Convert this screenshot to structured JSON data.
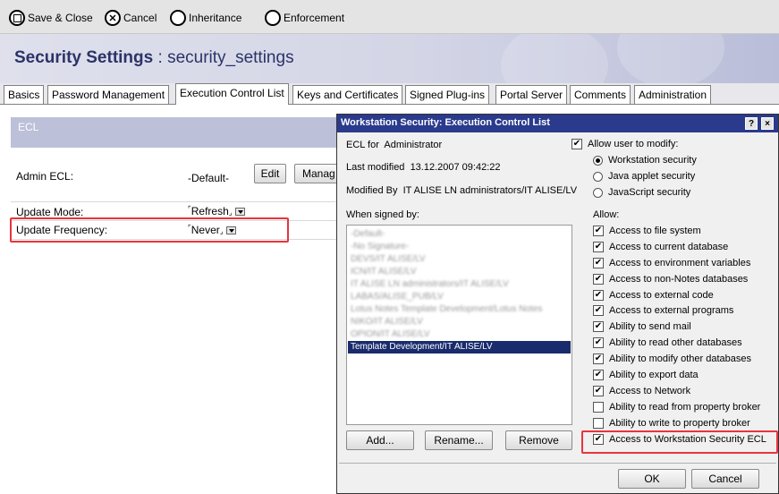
{
  "toolbar": {
    "save_close": "Save & Close",
    "cancel": "Cancel",
    "inheritance": "Inheritance",
    "enforcement": "Enforcement"
  },
  "header": {
    "title": "Security Settings",
    "separator": ":",
    "subtitle": "security_settings"
  },
  "tabs": [
    "Basics",
    "Password Management",
    "Execution Control List",
    "Keys and Certificates",
    "Signed Plug-ins",
    "Portal Server",
    "Comments",
    "Administration"
  ],
  "form": {
    "section": "ECL",
    "admin_ecl_label": "Admin ECL:",
    "admin_ecl_value": "-Default-",
    "edit_button": "Edit",
    "manage_button": "Manag",
    "update_mode_label": "Update Mode:",
    "update_mode_value": "Refresh",
    "update_frequency_label": "Update Frequency:",
    "update_frequency_value": "Never"
  },
  "dialog": {
    "title": "Workstation Security:  Execution Control List",
    "help": "?",
    "close": "×",
    "ecl_for_label": "ECL for",
    "ecl_for_value": "Administrator",
    "last_modified_label": "Last modified",
    "last_modified_value": "13.12.2007 09:42:22",
    "modified_by_label": "Modified By",
    "modified_by_value": "IT ALISE LN administrators/IT ALISE/LV",
    "when_signed_by": "When signed by:",
    "signers": [
      {
        "name": "-Default-",
        "blurred": true
      },
      {
        "name": "-No Signature-",
        "blurred": true
      },
      {
        "name": "DEVS/IT ALISE/LV",
        "blurred": true
      },
      {
        "name": "ICN/IT ALISE/LV",
        "blurred": true
      },
      {
        "name": "IT ALISE LN administrators/IT ALISE/LV",
        "blurred": true
      },
      {
        "name": "LABAS/ALISE_PUB/LV",
        "blurred": true
      },
      {
        "name": "Lotus Notes Template Development/Lotus Notes",
        "blurred": true
      },
      {
        "name": "NIKO/IT ALISE/LV",
        "blurred": true
      },
      {
        "name": "OPION/IT ALISE/LV",
        "blurred": true
      },
      {
        "name": "Template Development/IT ALISE/LV",
        "blurred": false,
        "selected": true
      }
    ],
    "add_button": "Add...",
    "rename_button": "Rename...",
    "remove_button": "Remove",
    "allow_modify_label": "Allow user to modify:",
    "allow_modify_checked": true,
    "modify_options": [
      {
        "label": "Workstation security",
        "selected": true
      },
      {
        "label": "Java applet security",
        "selected": false
      },
      {
        "label": "JavaScript security",
        "selected": false
      }
    ],
    "allow_label": "Allow:",
    "permissions": [
      {
        "label": "Access to file system",
        "checked": true
      },
      {
        "label": "Access to current database",
        "checked": true
      },
      {
        "label": "Access to environment variables",
        "checked": true
      },
      {
        "label": "Access to non-Notes databases",
        "checked": true
      },
      {
        "label": "Access to external code",
        "checked": true
      },
      {
        "label": "Access to external programs",
        "checked": true
      },
      {
        "label": "Ability to send mail",
        "checked": true
      },
      {
        "label": "Ability to read other databases",
        "checked": true
      },
      {
        "label": "Ability to modify other databases",
        "checked": true
      },
      {
        "label": "Ability to export data",
        "checked": true
      },
      {
        "label": "Access to Network",
        "checked": true
      },
      {
        "label": "Ability to read from property broker",
        "checked": false
      },
      {
        "label": "Ability to write to property broker",
        "checked": false
      },
      {
        "label": "Access to Workstation Security ECL",
        "checked": true
      }
    ],
    "ok_button": "OK",
    "cancel_button": "Cancel"
  },
  "colors": {
    "highlight_box": "#e8343c",
    "dialog_title_bar": "#2a3a8c",
    "selected_row": "#1a2b6d",
    "page_title": "#2b3369"
  }
}
